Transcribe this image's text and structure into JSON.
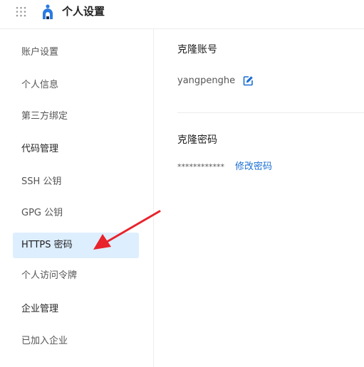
{
  "header": {
    "app_title": "个人设置",
    "icons": [
      "grid-menu-icon",
      "app-logo-icon"
    ]
  },
  "sidebar": {
    "items": [
      {
        "label": "账户设置"
      },
      {
        "label": "个人信息"
      },
      {
        "label": "第三方绑定"
      },
      {
        "label": "代码管理"
      },
      {
        "label": "SSH 公钥"
      },
      {
        "label": "GPG 公钥"
      },
      {
        "label": "HTTPS 密码",
        "active": true
      },
      {
        "label": "个人访问令牌"
      },
      {
        "label": "企业管理"
      },
      {
        "label": "已加入企业"
      }
    ]
  },
  "main": {
    "clone_account": {
      "title": "克隆账号",
      "username": "yangpenghe",
      "edit_icon": "edit-icon"
    },
    "clone_password": {
      "title": "克隆密码",
      "masked_value": "************",
      "change_link": "修改密码"
    }
  },
  "colors": {
    "accent": "#1a6fd3",
    "active_background": "#ddeefe",
    "annotation_arrow": "#e8232b"
  }
}
